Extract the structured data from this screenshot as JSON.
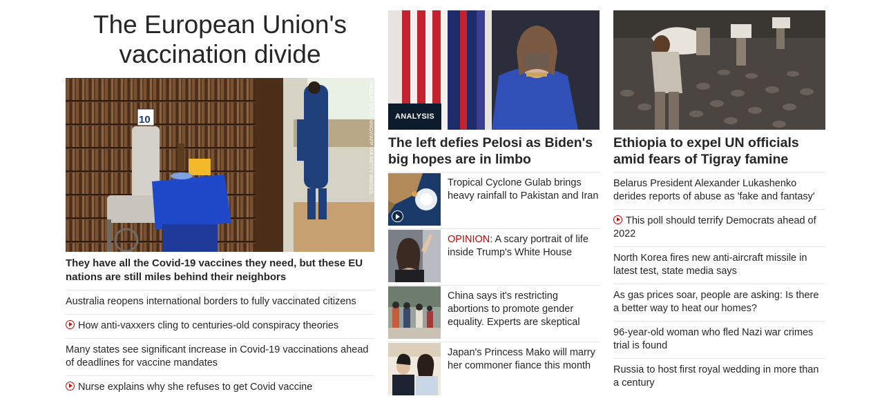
{
  "col1": {
    "title": "The European Union's vaccination divide",
    "photo_credit": "NIKOLAY DOYCHINOV/AFP VIA GETTY IMAGES",
    "headline": "They have all the Covid-19 vaccines they need, but these EU nations are still miles behind their neighbors",
    "items": [
      {
        "text": "Australia reopens international borders to fully vaccinated citizens",
        "video": false
      },
      {
        "text": "How anti-vaxxers cling to centuries-old conspiracy theories",
        "video": true
      },
      {
        "text": "Many states see significant increase in Covid-19 vaccinations ahead of deadlines for vaccine mandates",
        "video": false
      },
      {
        "text": "Nurse explains why she refuses to get Covid vaccine",
        "video": true
      }
    ]
  },
  "col2": {
    "badge": "ANALYSIS",
    "headline": "The left defies Pelosi as Biden's big hopes are in limbo",
    "items": [
      {
        "prefix": "",
        "text": "Tropical Cyclone Gulab brings heavy rainfall to Pakistan and Iran",
        "video": true
      },
      {
        "prefix": "OPINION",
        "text": ": A scary portrait of life inside Trump's White House",
        "video": false
      },
      {
        "prefix": "",
        "text": "China says it's restricting abortions to promote gender equality. Experts are skeptical",
        "video": false
      },
      {
        "prefix": "",
        "text": "Japan's Princess Mako will marry her commoner fiance this month",
        "video": false
      }
    ]
  },
  "col3": {
    "headline": "Ethiopia to expel UN officials amid fears of Tigray famine",
    "items": [
      {
        "text": "Belarus President Alexander Lukashenko derides reports of abuse as 'fake and fantasy'",
        "video": false
      },
      {
        "text": "This poll should terrify Democrats ahead of 2022",
        "video": true
      },
      {
        "text": "North Korea fires new anti-aircraft missile in latest test, state media says",
        "video": false
      },
      {
        "text": "As gas prices soar, people are asking: Is there a better way to heat our homes?",
        "video": false
      },
      {
        "text": "96-year-old woman who fled Nazi war crimes trial is found",
        "video": false
      },
      {
        "text": "Russia to host first royal wedding in more than a century",
        "video": false
      }
    ]
  },
  "colors": {
    "accent_red": "#cc0000",
    "text": "#262626",
    "divider": "#e5e5e5",
    "badge_bg": "#0c1c2c"
  }
}
